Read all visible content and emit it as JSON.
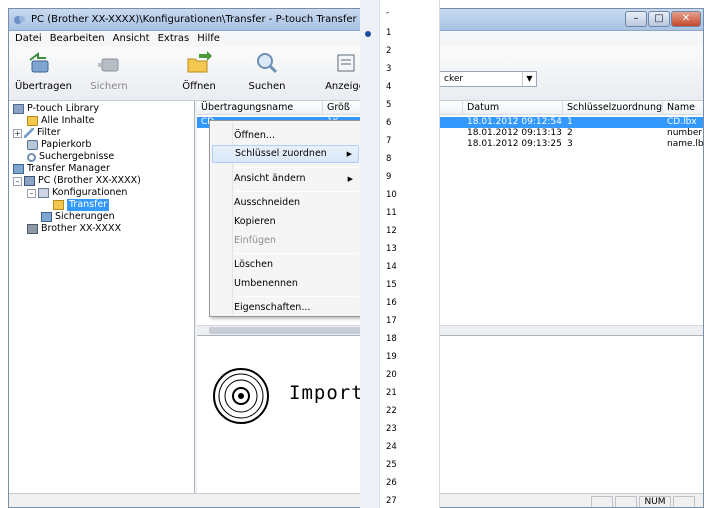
{
  "titlebar": {
    "title": "PC (Brother XX-XXXX)\\Konfigurationen\\Transfer - P-touch Transfer Manag"
  },
  "menu": [
    "Datei",
    "Bearbeiten",
    "Ansicht",
    "Extras",
    "Hilfe"
  ],
  "toolbar": {
    "transfer": "Übertragen",
    "save": "Sichern",
    "open": "Öffnen",
    "search": "Suchen",
    "view": "Anzeige",
    "printer_partial": "cker"
  },
  "tree": [
    "P-touch Library",
    "Alle Inhalte",
    "Filter",
    "Papierkorb",
    "Suchergebnisse",
    "Transfer Manager",
    "PC (Brother XX-XXXX)",
    "Konfigurationen",
    "Transfer",
    "Sicherungen",
    "Brother XX-XXXX"
  ],
  "list": {
    "columns": [
      "Übertragungsname",
      "Größ",
      "Datum",
      "Schlüsselzuordnung",
      "Name"
    ],
    "rows": [
      {
        "name": "CD",
        "size": "1K",
        "date": "18.01.2012 09:12:54",
        "key": "1",
        "file": "CD.lbx"
      },
      {
        "name": "",
        "size": "",
        "date": "18.01.2012 09:13:13",
        "key": "2",
        "file": "number"
      },
      {
        "name": "",
        "size": "",
        "date": "18.01.2012 09:13:25",
        "key": "3",
        "file": "name.lb"
      }
    ]
  },
  "preview": {
    "text": "Import data"
  },
  "context_menu": {
    "open": "Öffnen...",
    "assign_key": "Schlüssel zuordnen",
    "change_view": "Ansicht ändern",
    "cut": "Ausschneiden",
    "copy": "Kopieren",
    "paste": "Einfügen",
    "delete": "Löschen",
    "rename": "Umbenennen",
    "properties": "Eigenschaften..."
  },
  "key_list": [
    "-",
    "1",
    "2",
    "3",
    "4",
    "5",
    "6",
    "7",
    "8",
    "9",
    "10",
    "11",
    "12",
    "13",
    "14",
    "15",
    "16",
    "17",
    "18",
    "19",
    "20",
    "21",
    "22",
    "23",
    "24",
    "25",
    "26",
    "27"
  ],
  "status": {
    "num": "NUM"
  },
  "colors": {
    "selection": "#3399ff",
    "titlebar": "#b7cde9"
  }
}
